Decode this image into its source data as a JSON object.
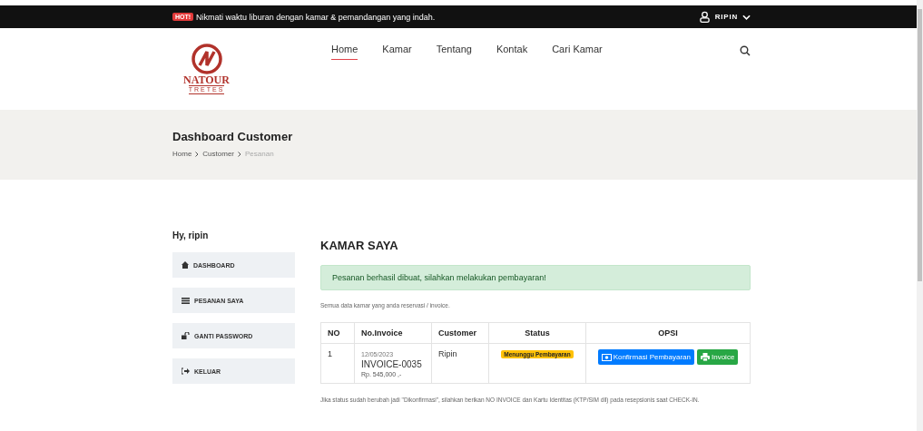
{
  "topbar": {
    "badge": "HOT!",
    "message": "Nikmati waktu liburan dengan kamar & pemandangan yang indah.",
    "user": "RIPIN"
  },
  "logo": {
    "name": "NATOUR",
    "subtitle": "TRETES"
  },
  "nav": [
    {
      "label": "Home",
      "selected": true
    },
    {
      "label": "Kamar",
      "selected": false
    },
    {
      "label": "Tentang",
      "selected": false
    },
    {
      "label": "Kontak",
      "selected": false
    },
    {
      "label": "Cari Kamar",
      "selected": false
    }
  ],
  "banner": {
    "title": "Dashboard Customer",
    "breadcrumb": [
      {
        "label": "Home",
        "current": false
      },
      {
        "label": "Customer",
        "current": false
      },
      {
        "label": "Pesanan",
        "current": true
      }
    ]
  },
  "sidebar": {
    "greeting": "Hy, ripin",
    "items": [
      {
        "label": "DASHBOARD",
        "kind": "home"
      },
      {
        "label": "PESANAN SAYA",
        "kind": "list"
      },
      {
        "label": "GANTI PASSWORD",
        "kind": "unlock"
      },
      {
        "label": "KELUAR",
        "kind": "signout"
      }
    ]
  },
  "main": {
    "title": "KAMAR SAYA",
    "alert": "Pesanan berhasil dibuat, silahkan melakukan pembayaran!",
    "note": "Semua data kamar yang anda reservasi / invoice.",
    "table": {
      "columns": [
        "NO",
        "No.Invoice",
        "Customer",
        "Status",
        "OPSI"
      ],
      "rows": [
        {
          "no": "1",
          "date": "12/05/2023",
          "invoice": "INVOICE-0035",
          "price": "Rp. 545,000 ,-",
          "customer": "Ripin",
          "status": "Menunggu Pembayaran",
          "actions": [
            {
              "label": "Konfirmasi Pembayaran",
              "kind": "confirm"
            },
            {
              "label": "Invoice",
              "kind": "print"
            }
          ]
        }
      ]
    },
    "footnote": "Jika status sudah berubah jadi \"Dikonfirmasi\", silahkan berikan NO INVOICE dan Kartu Identitas (KTP/SIM dll) pada resepsionis saat CHECK-IN."
  }
}
